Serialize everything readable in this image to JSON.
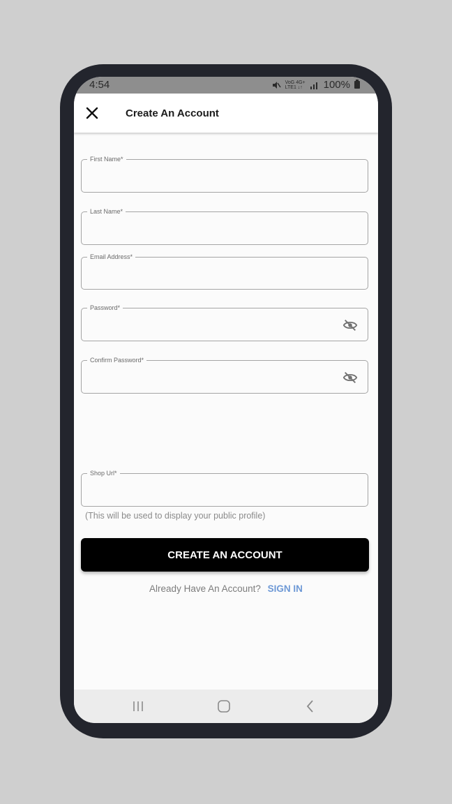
{
  "status_bar": {
    "time": "4:54",
    "net_top": "VoG 4G+",
    "net_bottom": "LTE1 ↓↑",
    "battery": "100%"
  },
  "app_bar": {
    "title": "Create An Account",
    "close_icon": "close-icon"
  },
  "form": {
    "first_name": {
      "label": "First Name*",
      "value": ""
    },
    "last_name": {
      "label": "Last Name*",
      "value": ""
    },
    "email": {
      "label": "Email Address*",
      "value": ""
    },
    "password": {
      "label": "Password*",
      "value": "",
      "icon": "eye-off-icon"
    },
    "confirm_password": {
      "label": "Confirm Password*",
      "value": "",
      "icon": "eye-off-icon"
    },
    "shop_url": {
      "label": "Shop Url*",
      "value": "",
      "helper": "(This will be used to display your public profile)"
    }
  },
  "actions": {
    "create_label": "CREATE AN ACCOUNT",
    "have_account_text": "Already Have An Account?",
    "sign_in_label": "SIGN IN"
  },
  "colors": {
    "primary_button": "#000000",
    "link": "#6e99d6",
    "field_border": "#a5a5a5"
  }
}
